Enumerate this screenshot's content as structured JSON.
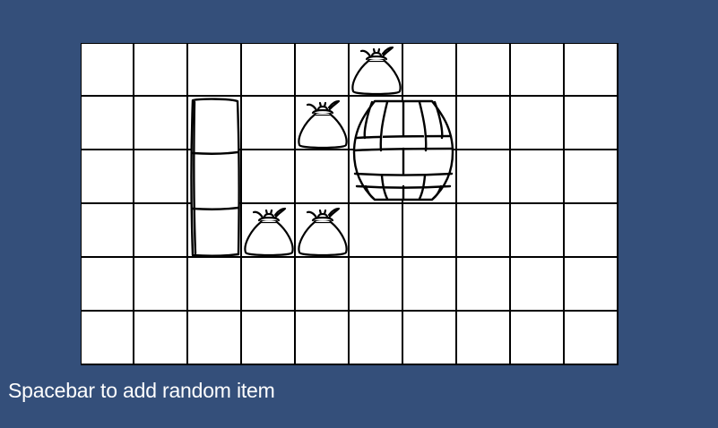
{
  "inventory": {
    "columns": 10,
    "rows": 6,
    "items": [
      {
        "type": "sack",
        "col": 5,
        "row": 0,
        "w": 1,
        "h": 1
      },
      {
        "type": "sack",
        "col": 4,
        "row": 1,
        "w": 1,
        "h": 1
      },
      {
        "type": "barrel",
        "col": 5,
        "row": 1,
        "w": 2,
        "h": 2
      },
      {
        "type": "crate-column",
        "col": 2,
        "row": 1,
        "w": 1,
        "h": 3
      },
      {
        "type": "sack",
        "col": 3,
        "row": 3,
        "w": 1,
        "h": 1
      },
      {
        "type": "sack",
        "col": 4,
        "row": 3,
        "w": 1,
        "h": 1
      }
    ]
  },
  "hint_text": "Spacebar to add random item",
  "colors": {
    "background": "#344f7a",
    "grid_fill": "#ffffff",
    "grid_lines": "#000000",
    "hint_text": "#ffffff"
  }
}
